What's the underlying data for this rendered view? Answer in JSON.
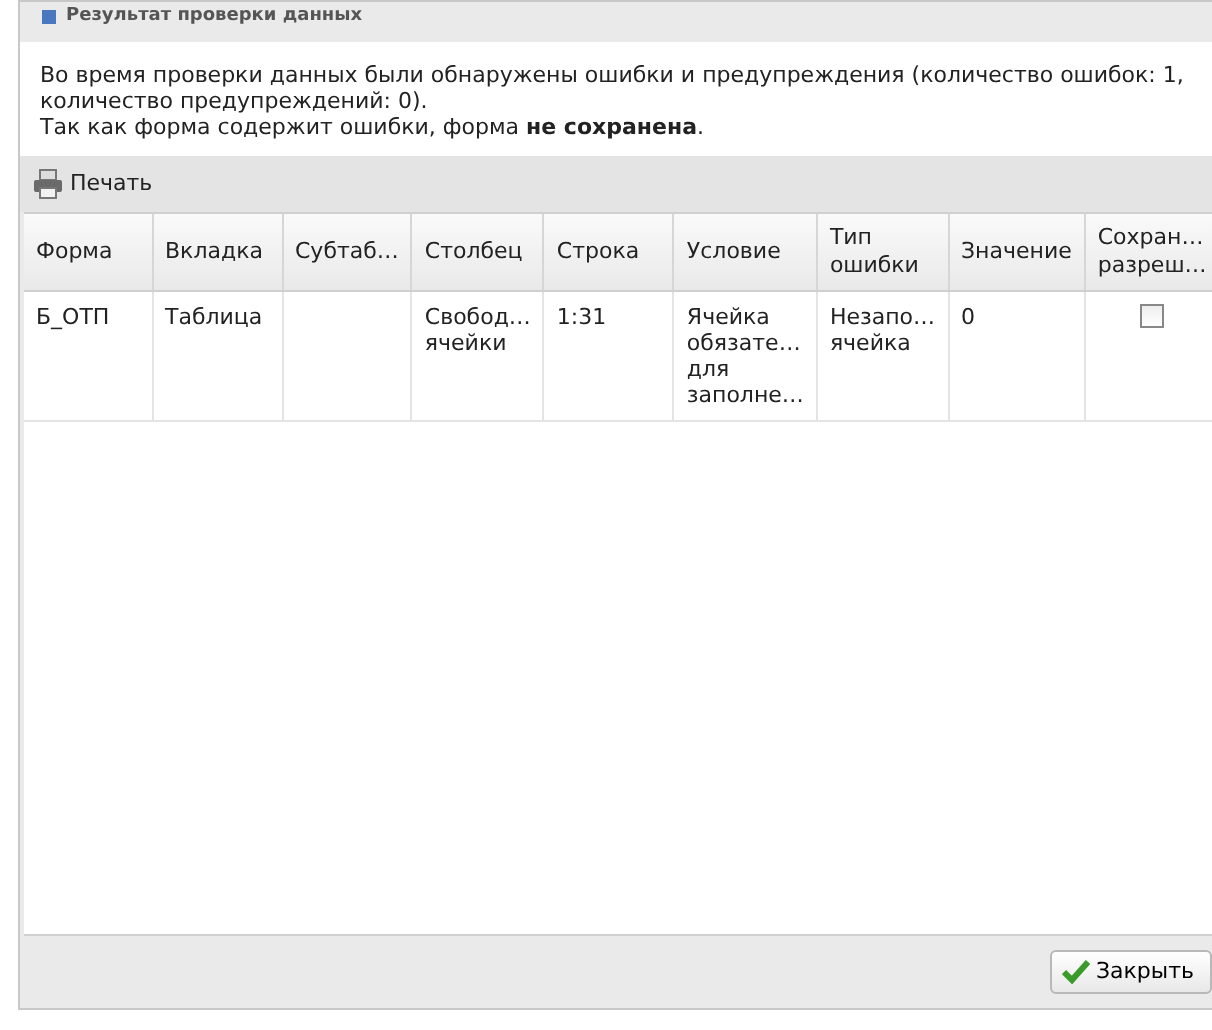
{
  "window": {
    "title": "Результат проверки данных"
  },
  "message": {
    "text": "Во время проверки данных были обнаружены ошибки и предупреждения (количество ошибок: 1, количество предупреждений: 0).",
    "text2": "Так как форма содержит ошибки, форма **не сохранена**."
  },
  "toolbar": {
    "print_label": "Печать"
  },
  "table": {
    "columns": [
      "Форма",
      "Вкладка",
      "Субтаб…",
      "Столбец",
      "Строка",
      "Условие",
      "Тип\nошибки",
      "Значение",
      "Сохран…\nразреш…"
    ],
    "rows": [
      {
        "cells": [
          "Б_ОТП",
          "Таблица",
          "",
          "Свобод…\nячейки",
          "1:31",
          "Ячейка\nобязате…\nдля\nзаполне…",
          "Незапо…\nячейка",
          "0"
        ],
        "checked": false
      }
    ]
  },
  "buttons": {
    "close_label": "Закрыть"
  }
}
